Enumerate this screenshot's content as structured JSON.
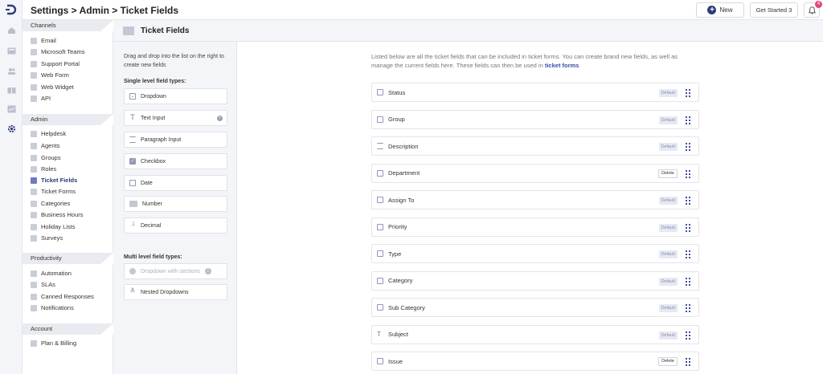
{
  "header": {
    "breadcrumb": "Settings > Admin > Ticket Fields",
    "new_label": "New",
    "get_started_label": "Get Started 3",
    "notification_count": "4"
  },
  "rail": {
    "icons": [
      "logo-icon",
      "home-icon",
      "inbox-icon",
      "contacts-icon",
      "knowledge-icon",
      "reports-icon",
      "settings-icon"
    ]
  },
  "sidebar": {
    "sections": [
      {
        "title": "Channels",
        "items": [
          "Email",
          "Microsoft Teams",
          "Support Portal",
          "Web Form",
          "Web Widget",
          "API"
        ]
      },
      {
        "title": "Admin",
        "items": [
          "Helpdesk",
          "Agents",
          "Groups",
          "Roles",
          "Ticket Fields",
          "Ticket Forms",
          "Categories",
          "Business Hours",
          "Holiday Lists",
          "Surveys"
        ]
      },
      {
        "title": "Productivity",
        "items": [
          "Automation",
          "SLAs",
          "Canned Responses",
          "Notifications"
        ]
      },
      {
        "title": "Account",
        "items": [
          "Plan & Billing"
        ]
      }
    ],
    "active_item": "Ticket Fields"
  },
  "palette": {
    "title": "Ticket Fields",
    "description": "Drag and drop into the list on the right to create new fields",
    "single_heading": "Single level field types:",
    "single_types": [
      "Dropdown",
      "Text Input",
      "Paragraph Input",
      "Checkbox",
      "Date",
      "Number",
      "Decimal"
    ],
    "multi_heading": "Multi level field types:",
    "multi_types": [
      "Dropdown with sections",
      "Nested Dropdowns"
    ]
  },
  "main": {
    "intro_text": "Listed below are all the ticket fields that can be included in ticket forms. You can create brand new fields, as well as manage the current fields here. These fields can then be used in ",
    "intro_link": "ticket forms",
    "intro_end": ".",
    "default_label": "Default",
    "delete_label": "Delete",
    "fields": [
      {
        "name": "Status",
        "tag": "Default"
      },
      {
        "name": "Group",
        "tag": "Default"
      },
      {
        "name": "Description",
        "tag": "Default"
      },
      {
        "name": "Department",
        "tag": "Delete"
      },
      {
        "name": "Assign To",
        "tag": "Default"
      },
      {
        "name": "Priority",
        "tag": "Default"
      },
      {
        "name": "Type",
        "tag": "Default"
      },
      {
        "name": "Category",
        "tag": "Default"
      },
      {
        "name": "Sub Category",
        "tag": "Default"
      },
      {
        "name": "Subject",
        "tag": "Default"
      },
      {
        "name": "Issue",
        "tag": "Delete"
      }
    ]
  },
  "colors": {
    "accent": "#2d3b7a",
    "link": "#3a4fa6",
    "badge": "#e8437b"
  }
}
